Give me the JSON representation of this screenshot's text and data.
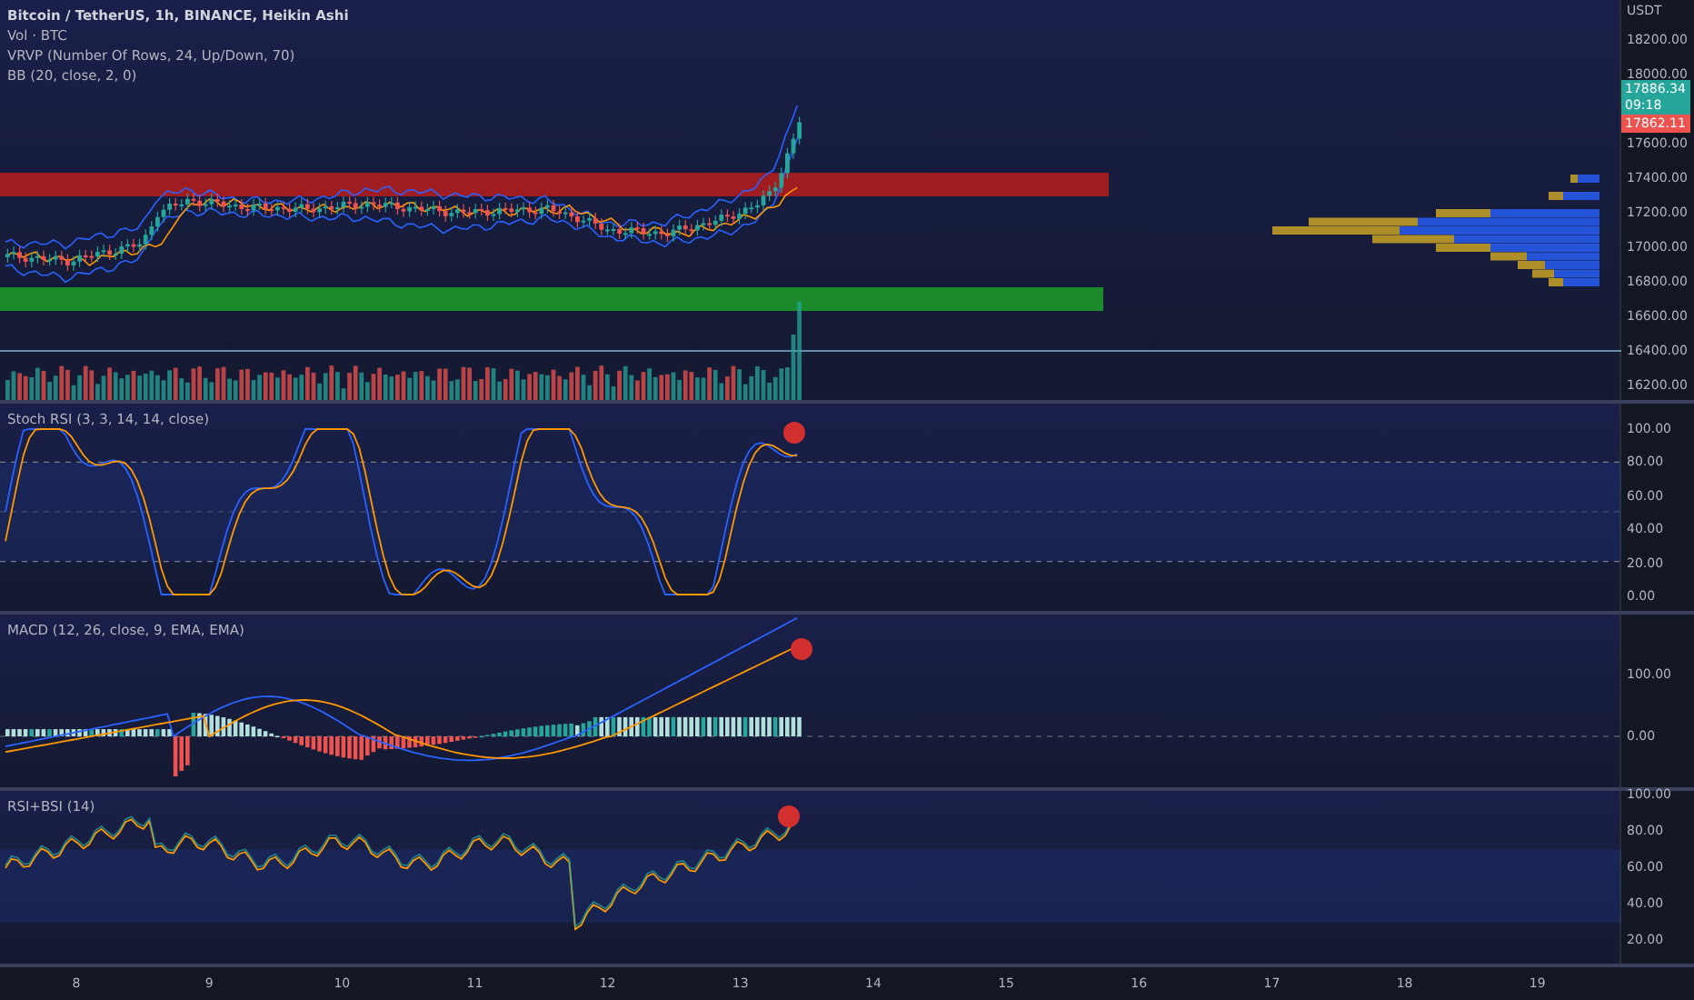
{
  "legend": {
    "title": "Bitcoin / TetherUS, 1h, BINANCE, Heikin Ashi",
    "lines": [
      "Vol · BTC",
      "VRVP (Number Of Rows, 24, Up/Down, 70)",
      "BB (20, close, 2, 0)"
    ]
  },
  "price_axis": {
    "currency": "USDT",
    "labels_above": [
      "18200.00",
      "18000.00"
    ],
    "labels_below": [
      "17600.00",
      "17400.00",
      "17200.00",
      "17000.00",
      "16800.00",
      "16600.00",
      "16400.00",
      "16200.00"
    ]
  },
  "price_badges": [
    {
      "kind": "last",
      "price": "17886.34",
      "countdown": "09:18",
      "color": "#26a69a"
    },
    {
      "kind": "open",
      "price": "17862.11",
      "color": "#ef5350"
    }
  ],
  "indicators": [
    {
      "kind": "stoch",
      "title": "Stoch RSI (3, 3, 14, 14, close)",
      "axis_labels": [
        "100.00",
        "80.00",
        "60.00",
        "40.00",
        "20.00",
        "0.00"
      ]
    },
    {
      "kind": "macd",
      "title": "MACD (12, 26, close, 9, EMA, EMA)",
      "axis_labels": [
        "100.00",
        "0.00"
      ]
    },
    {
      "kind": "rsi",
      "title": "RSI+BSI (14)",
      "axis_labels": [
        "100.00",
        "80.00",
        "60.00",
        "40.00",
        "20.00"
      ]
    }
  ],
  "time_axis": [
    "8",
    "9",
    "10",
    "11",
    "12",
    "13",
    "14",
    "15",
    "16",
    "17",
    "18",
    "19"
  ]
}
